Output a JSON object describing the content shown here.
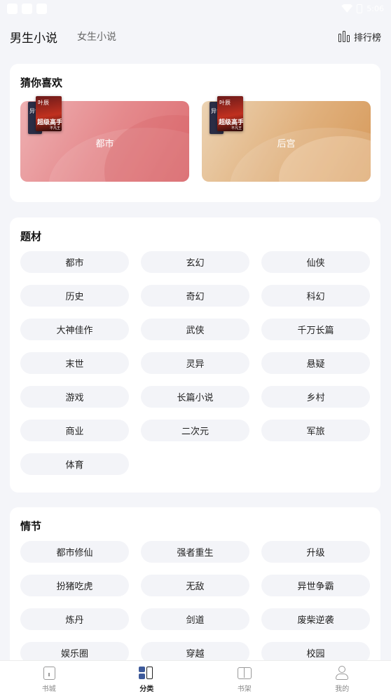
{
  "status_bar": {
    "time": "5:06"
  },
  "top_nav": {
    "tabs": [
      {
        "label": "男生小说",
        "active": true
      },
      {
        "label": "女生小说",
        "active": false
      }
    ],
    "rank_label": "排行榜"
  },
  "guess": {
    "title": "猜你喜欢",
    "tiles": [
      {
        "label": "都市",
        "book_cover_title": "超级高手",
        "book_cover_author": "叶辰",
        "book_cover_sub": "不凡王"
      },
      {
        "label": "后宫",
        "book_cover_title": "超级高手",
        "book_cover_author": "叶辰",
        "book_cover_sub": "不凡王"
      }
    ]
  },
  "themes": {
    "title": "题材",
    "tags": [
      "都市",
      "玄幻",
      "仙侠",
      "历史",
      "奇幻",
      "科幻",
      "大神佳作",
      "武侠",
      "千万长篇",
      "末世",
      "灵异",
      "悬疑",
      "游戏",
      "长篇小说",
      "乡村",
      "商业",
      "二次元",
      "军旅",
      "体育"
    ]
  },
  "plots": {
    "title": "情节",
    "tags": [
      "都市修仙",
      "强者重生",
      "升级",
      "扮猪吃虎",
      "无敌",
      "异世争霸",
      "炼丹",
      "剑道",
      "废柴逆袭",
      "娱乐圈",
      "穿越",
      "校园"
    ]
  },
  "tabbar": {
    "items": [
      {
        "label": "书城",
        "icon": "store-icon",
        "active": false
      },
      {
        "label": "分类",
        "icon": "category-icon",
        "active": true
      },
      {
        "label": "书架",
        "icon": "bookshelf-icon",
        "active": false
      },
      {
        "label": "我的",
        "icon": "profile-icon",
        "active": false
      }
    ]
  },
  "colors": {
    "accent": "#3e5a9a",
    "background": "#f4f5f9",
    "tag_bg": "#f3f4f8"
  }
}
